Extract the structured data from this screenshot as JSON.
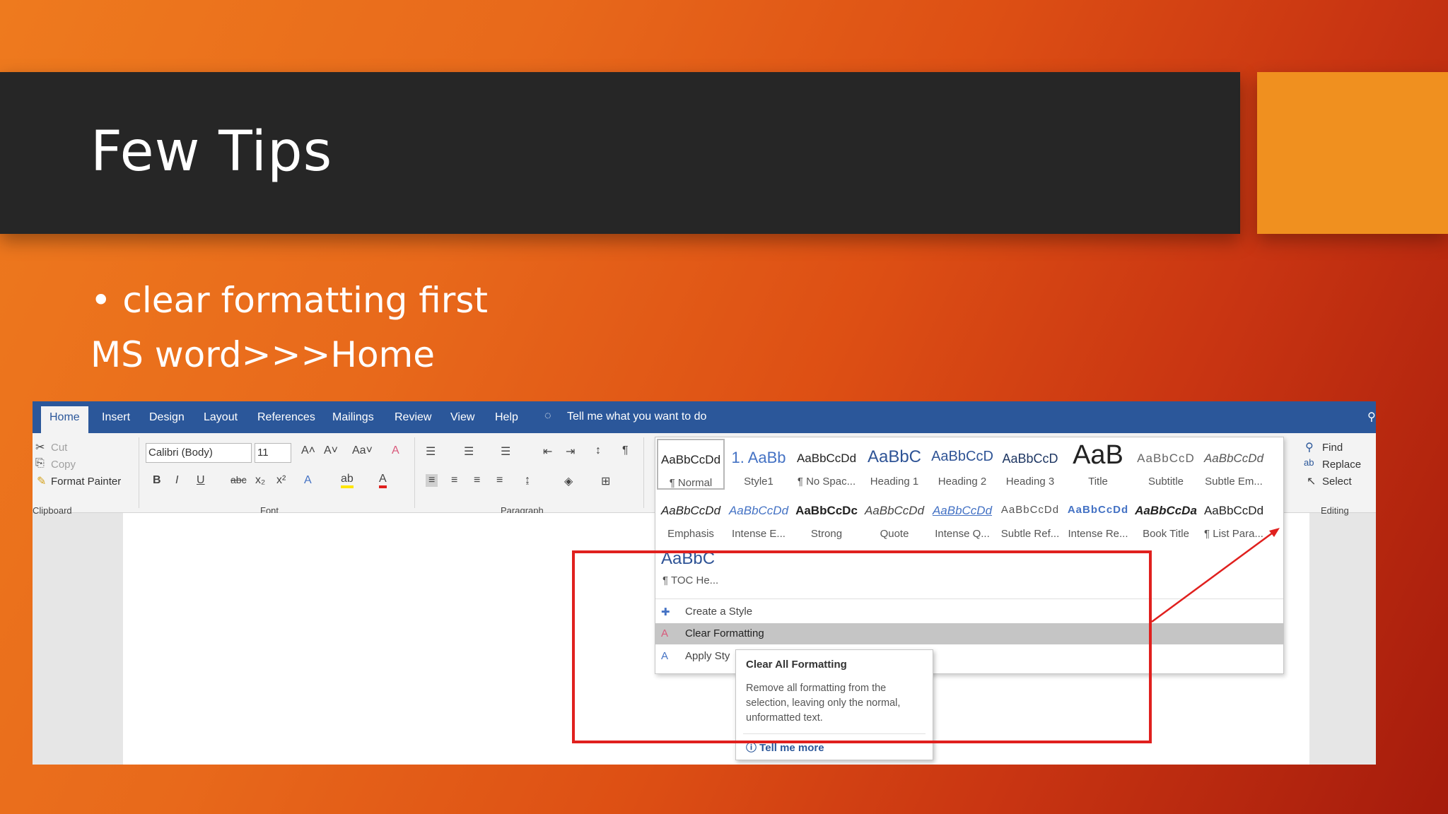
{
  "slide": {
    "title": "Few Tips",
    "bullet": "clear formatting first",
    "subline": "MS word>>>Home"
  },
  "word": {
    "tabs": [
      "Home",
      "Insert",
      "Design",
      "Layout",
      "References",
      "Mailings",
      "Review",
      "View",
      "Help"
    ],
    "tell_me": "Tell me what you want to do",
    "clipboard": {
      "cut": "Cut",
      "copy": "Copy",
      "format_painter": "Format Painter",
      "label": "Clipboard"
    },
    "font": {
      "name": "Calibri (Body)",
      "size": "11",
      "label": "Font"
    },
    "paragraph": {
      "label": "Paragraph"
    },
    "editing": {
      "find": "Find",
      "replace": "Replace",
      "select": "Select",
      "label": "Editing"
    },
    "styles_row1": [
      {
        "preview": "AaBbCcDd",
        "name": "¶ Normal"
      },
      {
        "preview": "1. AaBb",
        "name": "Style1"
      },
      {
        "preview": "AaBbCcDd",
        "name": "¶ No Spac..."
      },
      {
        "preview": "AaBbC",
        "name": "Heading 1"
      },
      {
        "preview": "AaBbCcD",
        "name": "Heading 2"
      },
      {
        "preview": "AaBbCcD",
        "name": "Heading 3"
      },
      {
        "preview": "AaB",
        "name": "Title"
      },
      {
        "preview": "AaBbCcD",
        "name": "Subtitle"
      },
      {
        "preview": "AaBbCcDd",
        "name": "Subtle Em..."
      }
    ],
    "styles_row2": [
      {
        "preview": "AaBbCcDd",
        "name": "Emphasis"
      },
      {
        "preview": "AaBbCcDd",
        "name": "Intense E..."
      },
      {
        "preview": "AaBbCcDc",
        "name": "Strong"
      },
      {
        "preview": "AaBbCcDd",
        "name": "Quote"
      },
      {
        "preview": "AaBbCcDd",
        "name": "Intense Q..."
      },
      {
        "preview": "AaBbCcDd",
        "name": "Subtle Ref..."
      },
      {
        "preview": "AaBbCcDd",
        "name": "Intense Re..."
      },
      {
        "preview": "AaBbCcDa",
        "name": "Book Title"
      },
      {
        "preview": "AaBbCcDd",
        "name": "¶ List Para..."
      }
    ],
    "style_toc": {
      "preview": "AaBbC",
      "name": "¶ TOC He..."
    },
    "menu": {
      "create": "Create a Style",
      "clear": "Clear Formatting",
      "apply": "Apply Sty"
    },
    "tooltip": {
      "title": "Clear All Formatting",
      "body": "Remove all formatting from the selection, leaving only the normal, unformatted text.",
      "link": "Tell me more"
    }
  },
  "colors": {
    "accent": "#f0901f",
    "ribbon_blue": "#2b579a",
    "highlight_red": "#e0201e"
  }
}
